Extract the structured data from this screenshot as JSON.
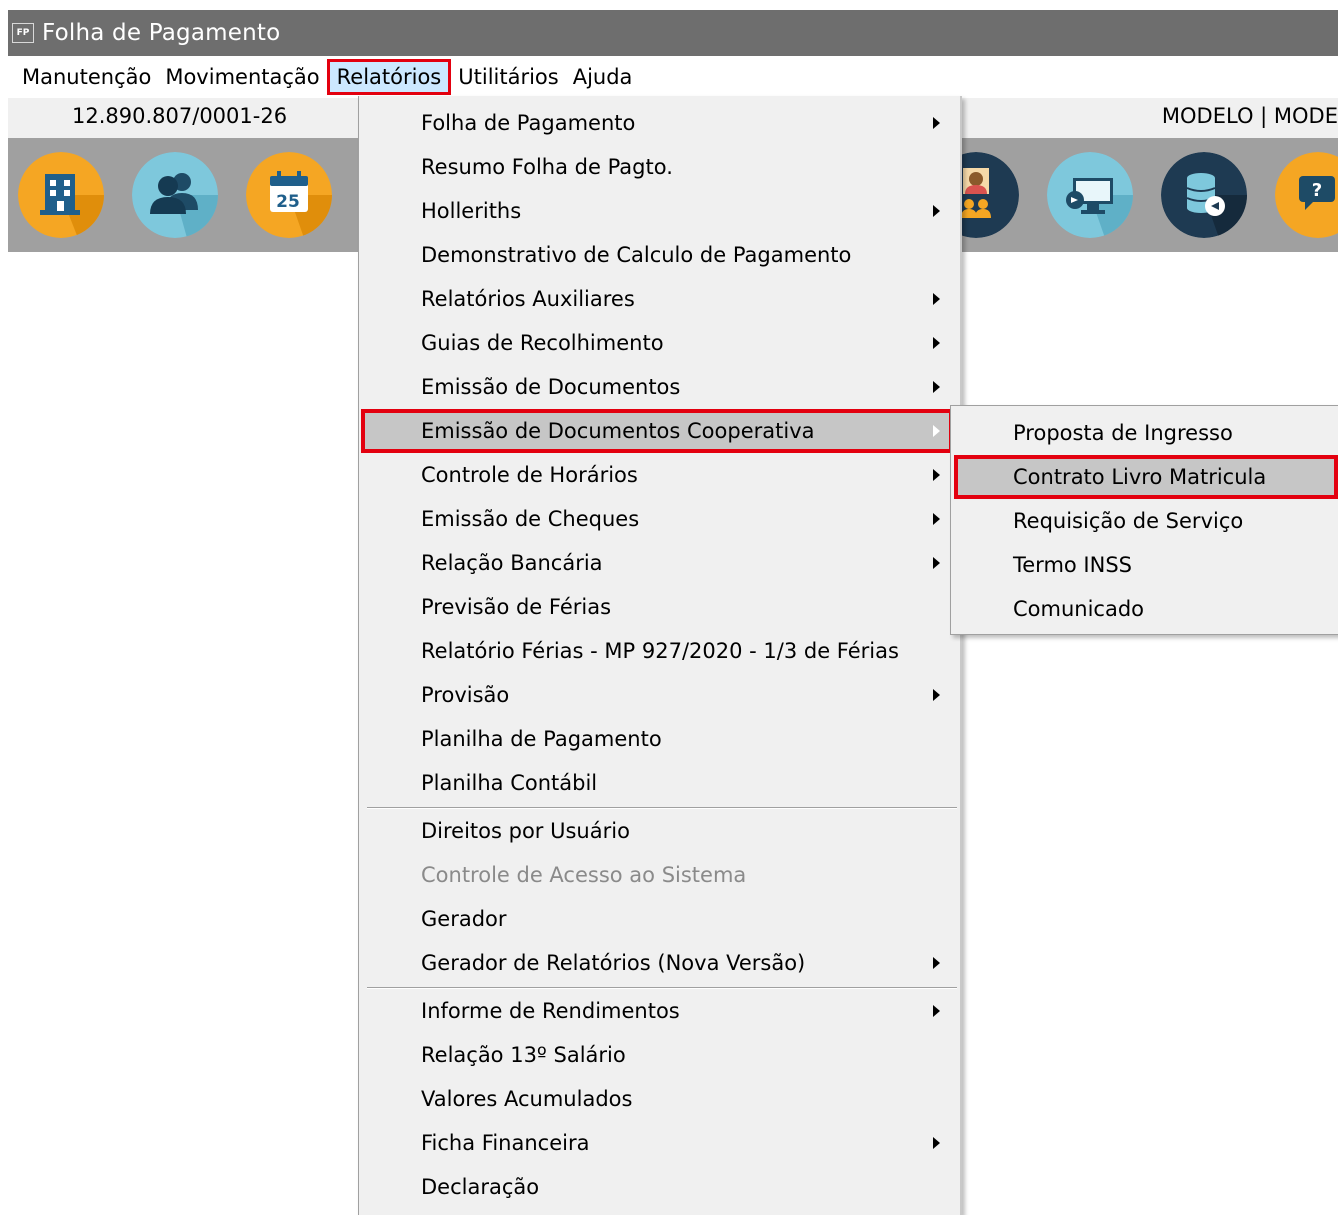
{
  "window": {
    "title": "Folha de Pagamento",
    "app_icon_text": "FP"
  },
  "menubar": {
    "items": [
      {
        "label": "Manutenção"
      },
      {
        "label": "Movimentação"
      },
      {
        "label": "Relatórios"
      },
      {
        "label": "Utilitários"
      },
      {
        "label": "Ajuda"
      }
    ],
    "active": "Relatórios"
  },
  "infobar": {
    "cnpj": "12.890.807/0001-26",
    "company": "MODELO | MODE"
  },
  "toolbar": {
    "icons": [
      "building-icon",
      "users-icon",
      "calendar-icon",
      "employee-group-icon",
      "monitor-export-icon",
      "database-import-icon",
      "help-icon"
    ],
    "calendar_day": "25",
    "help_mark": "?"
  },
  "dropdown": {
    "items": [
      {
        "label": "Folha de Pagamento",
        "submenu": true
      },
      {
        "label": "Resumo Folha de Pagto.",
        "submenu": false
      },
      {
        "label": "Holleriths",
        "submenu": true
      },
      {
        "label": "Demonstrativo de Calculo de Pagamento",
        "submenu": false
      },
      {
        "label": "Relatórios Auxiliares",
        "submenu": true
      },
      {
        "label": "Guias de Recolhimento",
        "submenu": true
      },
      {
        "label": "Emissão de Documentos",
        "submenu": true
      },
      {
        "label": "Emissão de Documentos Cooperativa",
        "submenu": true,
        "highlighted": true
      },
      {
        "label": "Controle de Horários",
        "submenu": true
      },
      {
        "label": "Emissão de Cheques",
        "submenu": true
      },
      {
        "label": "Relação Bancária",
        "submenu": true
      },
      {
        "label": "Previsão de Férias",
        "submenu": false
      },
      {
        "label": "Relatório Férias - MP 927/2020 - 1/3 de Férias",
        "submenu": false
      },
      {
        "label": "Provisão",
        "submenu": true
      },
      {
        "label": "Planilha de Pagamento",
        "submenu": false
      },
      {
        "label": "Planilha Contábil",
        "submenu": false
      },
      {
        "label": "Direitos por Usuário",
        "submenu": false
      },
      {
        "label": "Controle de Acesso ao Sistema",
        "submenu": false,
        "disabled": true
      },
      {
        "label": "Gerador",
        "submenu": false
      },
      {
        "label": "Gerador de Relatórios (Nova Versão)",
        "submenu": true
      },
      {
        "label": "Informe de Rendimentos",
        "submenu": true
      },
      {
        "label": "Relação 13º Salário",
        "submenu": false
      },
      {
        "label": "Valores Acumulados",
        "submenu": false
      },
      {
        "label": "Ficha Financeira",
        "submenu": true
      },
      {
        "label": "Declaração",
        "submenu": false
      }
    ]
  },
  "submenu": {
    "items": [
      {
        "label": "Proposta de Ingresso"
      },
      {
        "label": "Contrato Livro Matricula",
        "highlighted": true
      },
      {
        "label": "Requisição de Serviço"
      },
      {
        "label": "Termo INSS"
      },
      {
        "label": "Comunicado"
      }
    ]
  },
  "colors": {
    "titlebar": "#6e6e6e",
    "toolbar": "#a0a0a0",
    "highlight_border": "#e3000f",
    "menu_bg": "#f0f0f0",
    "selected_bg": "#c6c6c6"
  }
}
